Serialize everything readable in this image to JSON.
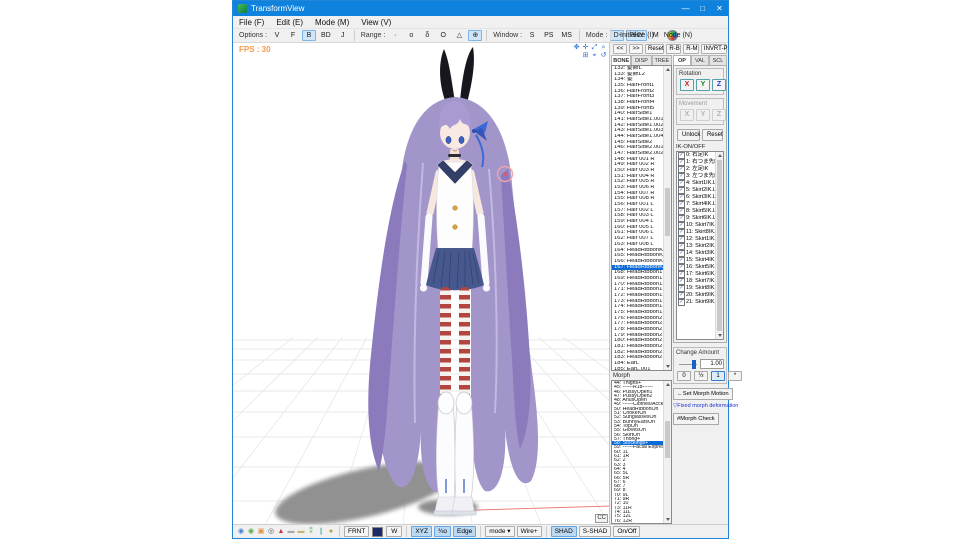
{
  "theme": {
    "titlebar_blue": "#0e82dc",
    "selection_blue": "#0a6ad6",
    "toggle_highlight": "#cfe6f8",
    "fps_orange": "#f49a4a",
    "note_blue": "#2431cc"
  },
  "window": {
    "title": "TransformView",
    "minimize": "—",
    "maximize": "□",
    "close": "✕"
  },
  "menubar": {
    "items": [
      "File (F)",
      "Edit (E)",
      "Mode (M)",
      "View (V)"
    ]
  },
  "options_toolbar": {
    "options_label": "Options :",
    "options_buttons": [
      {
        "label": "V"
      },
      {
        "label": "F"
      },
      {
        "label": "B",
        "active": true
      },
      {
        "label": "BD"
      },
      {
        "label": "J"
      }
    ],
    "range_label": "Range :",
    "range_buttons": [
      {
        "label": "·"
      },
      {
        "label": "o"
      },
      {
        "label": "δ"
      },
      {
        "label": "O"
      },
      {
        "label": "△"
      },
      {
        "label": "⊕",
        "active": true
      }
    ],
    "window_label": "Window :",
    "window_buttons": [
      {
        "label": "S"
      },
      {
        "label": "PS"
      },
      {
        "label": "MS"
      }
    ],
    "mode_label": "Mode :",
    "mode_buttons": [
      {
        "label": "D-",
        "active": true
      },
      {
        "label": "PHY",
        "active": true
      },
      {
        "label": "M"
      }
    ]
  },
  "init_menubar": {
    "items": [
      "Initialize (I)",
      "Node (N)"
    ]
  },
  "reset_row": {
    "buttons": [
      {
        "label": "<<"
      },
      {
        "label": ">>"
      },
      {
        "label": "Reset"
      },
      {
        "label": "R-B"
      },
      {
        "label": "R-M"
      },
      {
        "label": "INVRT-P"
      }
    ]
  },
  "viewport": {
    "fps": "FPS : 30",
    "cc_label": "CC",
    "view_icons_row1": [
      {
        "glyph": "✥",
        "name": "orbit-view-icon",
        "color": "#2f6fd6"
      },
      {
        "glyph": "✛",
        "name": "pan-view-icon",
        "color": "#2f6fd6"
      },
      {
        "glyph": "⤢",
        "name": "zoom-view-icon",
        "color": "#2f6fd6"
      },
      {
        "glyph": "⌕",
        "name": "magnifier-icon",
        "color": "#2f6fd6"
      }
    ],
    "view_icons_row2": [
      {
        "glyph": "⊞",
        "name": "grid-toggle-icon",
        "color": "#2f6fd6"
      },
      {
        "glyph": "⌖",
        "name": "center-view-icon",
        "color": "#2f6fd6"
      },
      {
        "glyph": "↺",
        "name": "reset-view-icon",
        "color": "#2f6fd6"
      }
    ]
  },
  "bone_panel": {
    "tabs": [
      {
        "label": "BONE",
        "active": true
      },
      {
        "label": "DISP"
      },
      {
        "label": "TREE"
      }
    ],
    "items": [
      "132: 髪飾L",
      "133: 髪飾L2",
      "134: 髪",
      "135: HairFront1",
      "136: HairFront2",
      "137: HairFront3",
      "138: HairFront4",
      "139: HairFront5",
      "140: HairSide1",
      "141: HairSide1.001",
      "142: HairSide1.002",
      "143: HairSide1.003",
      "144: HairSide1.004",
      "145: HairSide2",
      "146: HairSide2.001",
      "147: HairSide2.002",
      "148: Hair 001 R",
      "149: Hair 002 R",
      "150: Hair 003 R",
      "151: Hair 004 R",
      "152: Hair 005 R",
      "153: Hair 006 R",
      "154: Hair 007 R",
      "155: Hair 008 R",
      "156: Hair 001 L",
      "157: Hair 002 L",
      "158: Hair 003 L",
      "159: Hair 004 L",
      "160: Hair 005 L",
      "161: Hair 006 L",
      "162: Hair 007 L",
      "163: Hair 008 L",
      "164: HeadRibbonKnot1",
      "165: HeadRibbonKnot1",
      "166: HeadRibbonKnot2",
      {
        "label": "167: HeadRibbonKnot2",
        "selected": true
      },
      "168: HeadRibbon1",
      "169: HeadRibbon1.001",
      "170: HeadRibbon1.002",
      "171: HeadRibbon1.003",
      "172: HeadRibbon1.004",
      "173: HeadRibbon1.005",
      "174: HeadRibbon1.006",
      "175: HeadRibbon1.007",
      "176: HeadRibbon2",
      "177: HeadRibbon2.001",
      "178: HeadRibbon2.002",
      "179: HeadRibbon2.003",
      "180: HeadRibbon2.004",
      "181: HeadRibbon2.005",
      "182: HeadRibbon2.006",
      "183: HeadRibbon2.007",
      "184: EarL",
      "185: EarL.001"
    ]
  },
  "morph_panel": {
    "label": "Morph",
    "items": [
      "44: Thighs+",
      "45: ------R18------",
      "46: PussyOpen1",
      "47: PussyOpen2",
      "48: AnusOpen",
      "49: ------Clothes/Acce",
      "50: HeadRibbonOn",
      "51: ChokerOn",
      "52: SunglassesOn",
      "53: BunnyEarsOn",
      "54: TopOn",
      "55: GlovesOn",
      "56: SkirtOn",
      "57: Thong+",
      {
        "label": "58: Stockings+",
        "selected": true
      },
      "59: ------Facial Expressio",
      "60: 1L",
      "61: 1R",
      "62: 2",
      "63: 3",
      "64: 4",
      "65: 5L",
      "66: 5R",
      "67: 6",
      "68: 7",
      "69: 8",
      "70: 9L",
      "71: 9R",
      "72: 10",
      "73: 11R",
      "74: 11L",
      "75: 12L",
      "76: 12R",
      "77: 13",
      "78: ------Others------"
    ]
  },
  "control_panel": {
    "tabs": [
      {
        "label": "OP",
        "active": true
      },
      {
        "label": "VAL"
      },
      {
        "label": "SCL"
      }
    ],
    "rotation": {
      "label": "Rotation",
      "buttons": [
        {
          "label": "X",
          "color": "#c92222"
        },
        {
          "label": "Y",
          "color": "#118811"
        },
        {
          "label": "Z",
          "color": "#2233cc"
        }
      ]
    },
    "movement": {
      "label": "Movement",
      "buttons": [
        {
          "label": "X",
          "disabled": true
        },
        {
          "label": "Y",
          "disabled": true
        },
        {
          "label": "Z",
          "disabled": true
        }
      ]
    },
    "unlock_label": "Unlock",
    "reset_label": "Reset",
    "ik_label": "IK-ON/OFF",
    "ik_check_glyph": "✓",
    "ik_items": [
      "0: 右足IK",
      "1: 右つま先IK",
      "2: 左足IK",
      "3: 左つま先IK",
      "4: Skirt1IK.L",
      "5: Skirt2IK.L",
      "6: Skirt3IK.L",
      "7: Skirt4IK.L",
      "8: Skirt5IK.L",
      "9: Skirt6IK.L",
      "10: Skirt7IK.L",
      "11: Skirt8IK.L",
      "12: Skirt1IK.R",
      "13: Skirt2IK.R",
      "14: Skirt3IK.R",
      "15: Skirt4IK.R",
      "16: Skirt5IK.R",
      "17: Skirt6IK.R",
      "18: Skirt7IK.R",
      "19: Skirt8IK.R",
      "20: Skirt9IK.L",
      "21: Skirt9IK.R"
    ],
    "change_amount": {
      "label": "Change Amount",
      "value": "1.00",
      "quick_buttons": [
        {
          "label": "0"
        },
        {
          "label": "½"
        },
        {
          "label": "1",
          "active": true
        },
        {
          "label": "*"
        }
      ]
    },
    "set_morph_motion_label": "←Set Morph Motion",
    "fixed_morph_note": "▽Fixed morph deformation",
    "morph_check_label": "#Morph Check"
  },
  "bottom_bar": {
    "icons": [
      {
        "glyph": "◉",
        "name": "blue-ring-icon",
        "color": "#3f7fd0"
      },
      {
        "glyph": "◉",
        "name": "green-ring-icon",
        "color": "#5aa84e"
      },
      {
        "glyph": "▣",
        "name": "orange-square-icon",
        "color": "#e0903c"
      },
      {
        "glyph": "◎",
        "name": "dark-ring-icon",
        "color": "#555555"
      },
      {
        "glyph": "▲",
        "name": "red-triangle-icon",
        "color": "#cc3333"
      },
      {
        "glyph": "▬",
        "name": "gray-bar-icon",
        "color": "#a8a8a8"
      },
      {
        "glyph": "▬",
        "name": "khaki-bar-icon",
        "color": "#c8b070"
      },
      {
        "glyph": "⁑",
        "name": "green-dots-icon",
        "color": "#4ab04a"
      },
      {
        "glyph": "❙",
        "name": "teal-bar-icon",
        "color": "#52b8b0"
      },
      {
        "glyph": "●",
        "name": "olive-dot-icon",
        "color": "#b0a040"
      }
    ],
    "frnt_label": "FRNT",
    "w_label": "W",
    "toggles": [
      {
        "label": "XYZ",
        "active": true
      },
      {
        "label": "¾o",
        "active": true
      },
      {
        "label": "Edge",
        "active": true
      }
    ],
    "mode_label": "mode ▾",
    "wire_label": "Wire+",
    "shading": [
      {
        "label": "SHAD",
        "active": true
      },
      {
        "label": "S-SHAD"
      },
      {
        "label": "On/Off"
      }
    ]
  }
}
